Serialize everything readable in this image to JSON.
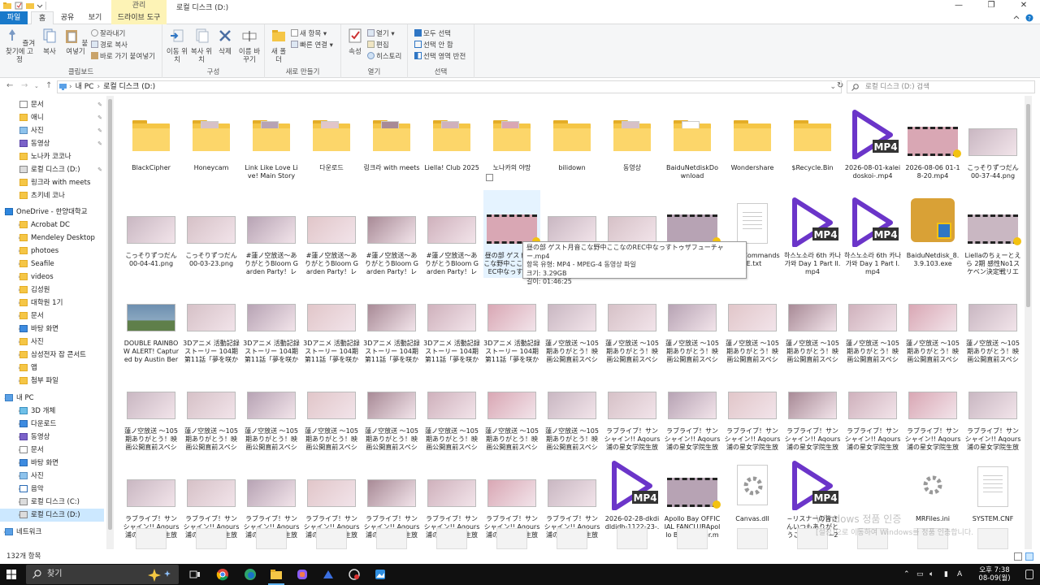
{
  "window": {
    "ctx_tab_label": "관리",
    "title": "로컬 디스크 (D:)",
    "min": "—",
    "max": "❐",
    "close": "✕"
  },
  "tabs": {
    "file": "파일",
    "home": "홈",
    "share": "공유",
    "view": "보기",
    "drive_tools": "드라이브 도구"
  },
  "ribbon": {
    "pin": "즐겨찾기에 고정",
    "copy": "복사",
    "paste": "붙여넣기",
    "cut": "잘라내기",
    "copy_path": "경로 복사",
    "paste_shortcut": "바로 가기 붙여넣기",
    "clipboard": "클립보드",
    "move_to": "이동 위치",
    "copy_to": "복사 위치",
    "delete": "삭제",
    "rename": "이름 바꾸기",
    "organize": "구성",
    "new_folder": "새 폴더",
    "new_item": "새 항목 ▾",
    "easy_access": "빠른 연결 ▾",
    "new": "새로 만들기",
    "properties": "속성",
    "open": "열기 ▾",
    "edit": "편집",
    "history": "히스토리",
    "open_group": "열기",
    "select_all": "모두 선택",
    "select_none": "선택 안 함",
    "invert_selection": "선택 영역 반전",
    "select_group": "선택"
  },
  "address": {
    "path_root": "내 PC",
    "path_drive": "로컬 디스크 (D:)",
    "search_placeholder": "로컬 디스크 (D:) 검색"
  },
  "nav": [
    {
      "label": "문서",
      "pinned": true
    },
    {
      "label": "애니",
      "pinned": true
    },
    {
      "label": "사진",
      "pinned": true
    },
    {
      "label": "동영상",
      "pinned": true
    },
    {
      "label": "노나카 코코나"
    },
    {
      "label": "로컬 디스크 (D:)",
      "pinned": true
    },
    {
      "label": "링크라 with meets"
    },
    {
      "label": "츠키네 코나"
    },
    {
      "label": "OneDrive - 한양대학교"
    },
    {
      "label": "Acrobat DC"
    },
    {
      "label": "Mendeley Desktop"
    },
    {
      "label": "photoes"
    },
    {
      "label": "Seafile"
    },
    {
      "label": "videos"
    },
    {
      "label": "김성원"
    },
    {
      "label": "대학원 1기"
    },
    {
      "label": "문서"
    },
    {
      "label": "바탕 화면"
    },
    {
      "label": "사진"
    },
    {
      "label": "삼성전자 잡 콘서트"
    },
    {
      "label": "앱"
    },
    {
      "label": "첨부 파일"
    },
    {
      "label": "내 PC"
    },
    {
      "label": "3D 개체"
    },
    {
      "label": "다운로드"
    },
    {
      "label": "동영상"
    },
    {
      "label": "문서"
    },
    {
      "label": "바탕 화면"
    },
    {
      "label": "사진"
    },
    {
      "label": "음악"
    },
    {
      "label": "로컬 디스크 (C:)"
    },
    {
      "label": "로컬 디스크 (D:)"
    },
    {
      "label": "네트워크"
    }
  ],
  "files": {
    "row1": [
      "BlackCipher",
      "Honeycam",
      "Link Like Love Live! Main Story",
      "다운로드",
      "링크라 with meets",
      "Liella! Club 2025",
      "노나카의 야망",
      "bilidown",
      "동영상",
      "BaiduNetdiskDownload",
      "Wondershare",
      "$Recycle.Bin",
      "2026-08-01-kaleidoskoi-.mp4",
      "2026-08-06 01-18-20.mp4",
      "こっそりずつだん 00-37-44.png"
    ],
    "row2": [
      "こっそりずつだん 00-04-41.png",
      "こっそりずつだん 00-03-23.png",
      "#蓮ノ空放送～ありがとうBloom Garden Party！レッツ…",
      "#蓮ノ空放送～ありがとうBloom Garden Party！レッツ…",
      "#蓮ノ空放送～ありがとうBloom Garden Party！レッツ…",
      "#蓮ノ空放送～ありがとうBloom Garden Party！レッツ…",
      "昼の部 ゲスト月音こな野中ここなのREC中なっすトゥザ…",
      "【ボイトレっ！】Lesson.18 ダイジ…",
      "【ボイトレっ！】Lesson.16 ダイ…",
      "夜の部野中ここなのREC中なっ…",
      "MenuCommands_E.txt",
      "하스노소라 6th 카나가와 Day 1 Part II.mp4",
      "하스노소라 6th 카나가와 Day 1 Part I.mp4",
      "BaiduNetdisk_8.3.9.103.exe",
      "Liellaのちぇーとえら 2期 感性No1スケベン決定戦リエラブ…"
    ],
    "row3": [
      "DOUBLE RAINBOW ALERT! Captured by Austin Berr…",
      "3Dアニメ 活動記録ストーリー 104期 第11話「夢を咲かせる…",
      "3Dアニメ 活動記録ストーリー 104期 第11話「夢を咲かせる…",
      "3Dアニメ 活動記録ストーリー 104期 第11話「夢を咲かせる…",
      "3Dアニメ 活動記録ストーリー 104期 第11話「夢を咲かせる…",
      "3Dアニメ 活動記録ストーリー 104期 第11話「夢を咲かせる…",
      "3Dアニメ 活動記録ストーリー 104期 第11話「夢を咲かせる…",
      "蓮ノ空放送 ～105期ありがとう！映画公開直前スペシャル…",
      "蓮ノ空放送 ～105期ありがとう！映画公開直前スペシャル…",
      "蓮ノ空放送 ～105期ありがとう！映画公開直前スペシャル…",
      "蓮ノ空放送 ～105期ありがとう！映画公開直前スペシャル…",
      "蓮ノ空放送 ～105期ありがとう！映画公開直前スペシャル…",
      "蓮ノ空放送 ～105期ありがとう！映画公開直前スペシャル…",
      "蓮ノ空放送 ～105期ありがとう！映画公開直前スペシャル…",
      "蓮ノ空放送 ～105期ありがとう！映画公開直前スペシャル…"
    ],
    "row4": [
      "蓮ノ空放送 ～105期ありがとう！映画公開直前スペシャル…",
      "蓮ノ空放送 ～105期ありがとう！映画公開直前スペシャル…",
      "蓮ノ空放送 ～105期ありがとう！映画公開直前スペシャル…",
      "蓮ノ空放送 ～105期ありがとう！映画公開直前スペシャル…",
      "蓮ノ空放送 ～105期ありがとう！映画公開直前スペシャル…",
      "蓮ノ空放送 ～105期ありがとう！映画公開直前スペシャル…",
      "蓮ノ空放送 ～105期ありがとう！映画公開直前スペシャル…",
      "蓮ノ空放送 ～105期ありがとう！映画公開直前スペシャル…",
      "ラブライブ！サンシャイン!! Aqours 浦の星女学院生放送!!! …",
      "ラブライブ！サンシャイン!! Aqours 浦の星女学院生放送!!! …",
      "ラブライブ！サンシャイン!! Aqours 浦の星女学院生放送!!! …",
      "ラブライブ！サンシャイン!! Aqours 浦の星女学院生放送!!! …",
      "ラブライブ！サンシャイン!! Aqours 浦の星女学院生放送!!! …",
      "ラブライブ！サンシャイン!! Aqours 浦の星女学院生放送!!! …",
      "ラブライブ！サンシャイン!! Aqours 浦の星女学院生放送!!! …"
    ],
    "row5": [
      "ラブライブ！サンシャイン!! Aqours 浦の星女学院生放送!!! …",
      "ラブライブ！サンシャイン!! Aqours 浦の星女学院生放送!!! …",
      "ラブライブ！サンシャイン!! Aqours 浦の星女学院生放送!!! …",
      "ラブライブ！サンシャイン!! Aqours 浦の星女学院生放送!!! …",
      "ラブライブ！サンシャイン!! Aqours 浦の星女学院生放送!!! …",
      "ラブライブ！サンシャイン!! Aqours 浦の星女学院生放送!!! …",
      "ラブライブ！サンシャイン!! Aqours 浦の星女学院生放送!!! …",
      "ラブライブ！サンシャイン!! Aqours 浦の星女学院生放送!!! …",
      "2026-02-28-dkdidldidh-1122-23-.mp4",
      "Apollo Bay OFFICIAL FANCLUBApollo Bay Cruiser.mp4",
      "Canvas.dll",
      "~リスナーの皆さんいつもありがとうございます!~2部.mp4",
      "",
      "MRFiles.ini",
      "SYSTEM.CNF"
    ]
  },
  "tooltip": {
    "line1": "昼の部 ゲスト月音こな野中ここなのREC中なっすトゥザフューチャー.mp4",
    "line2": "항목 유형: MP4 - MPEG-4 동영상 파일",
    "line3": "크기: 3.29GB",
    "line4": "길이: 01:46:25"
  },
  "mp4_badge": "MP4",
  "watermark": {
    "line1": "Windows 정품 인증",
    "line2": "[설정]으로 이동하여 Windows를 정품 인증합니다."
  },
  "status": {
    "count": "132개 항목"
  },
  "taskbar": {
    "search": "찾기",
    "time": "오후 7:38",
    "date": "08-09(월)",
    "lang": "A"
  },
  "colors": {
    "file_tab": "#1979ca",
    "selection": "#cce8ff",
    "folder": "#f5c646",
    "mp4_play": "#6b35c9",
    "taskbar": "#101010"
  }
}
